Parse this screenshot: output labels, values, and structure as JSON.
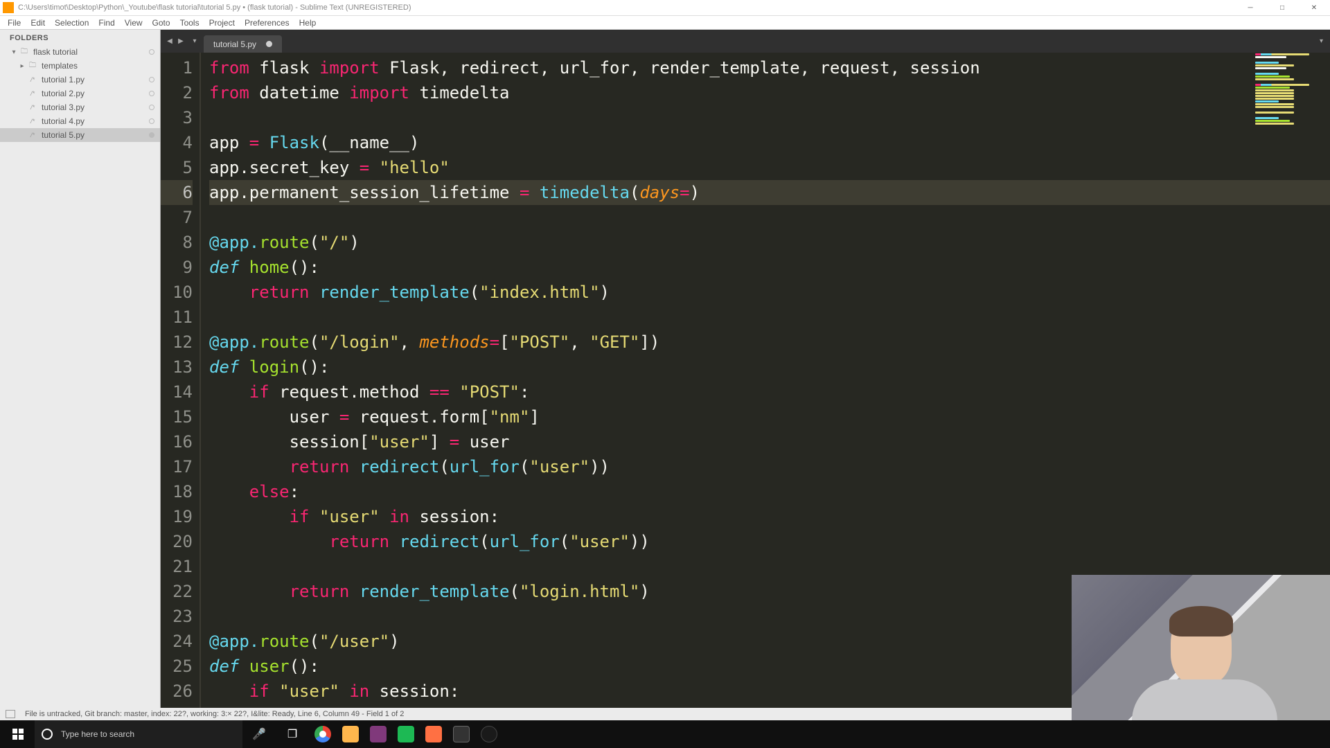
{
  "window": {
    "title": "C:\\Users\\timot\\Desktop\\Python\\_Youtube\\flask tutorial\\tutorial 5.py • (flask tutorial) - Sublime Text (UNREGISTERED)"
  },
  "menu": [
    "File",
    "Edit",
    "Selection",
    "Find",
    "View",
    "Goto",
    "Tools",
    "Project",
    "Preferences",
    "Help"
  ],
  "sidebar": {
    "title": "FOLDERS",
    "root": "flask tutorial",
    "template_folder": "templates",
    "files": [
      "tutorial 1.py",
      "tutorial 2.py",
      "tutorial 3.py",
      "tutorial 4.py",
      "tutorial 5.py"
    ],
    "active_index": 4
  },
  "tab": {
    "name": "tutorial 5.py",
    "dirty": true
  },
  "code": {
    "lines": [
      [
        [
          "kw",
          "from"
        ],
        [
          "pun",
          " flask "
        ],
        [
          "kw",
          "import"
        ],
        [
          "pun",
          " Flask"
        ],
        [
          "pun",
          ", "
        ],
        [
          "pun",
          "redirect"
        ],
        [
          "pun",
          ", "
        ],
        [
          "pun",
          "url_for"
        ],
        [
          "pun",
          ", "
        ],
        [
          "pun",
          "render_template"
        ],
        [
          "pun",
          ", "
        ],
        [
          "pun",
          "request"
        ],
        [
          "pun",
          ", "
        ],
        [
          "pun",
          "session"
        ]
      ],
      [
        [
          "kw",
          "from"
        ],
        [
          "pun",
          " datetime "
        ],
        [
          "kw",
          "import"
        ],
        [
          "pun",
          " timedelta"
        ]
      ],
      [
        [
          "pun",
          ""
        ]
      ],
      [
        [
          "pun",
          "app "
        ],
        [
          "op",
          "="
        ],
        [
          "pun",
          " "
        ],
        [
          "call",
          "Flask"
        ],
        [
          "pun",
          "(__name__)"
        ]
      ],
      [
        [
          "pun",
          "app.secret_key "
        ],
        [
          "op",
          "="
        ],
        [
          "pun",
          " "
        ],
        [
          "str",
          "\"hello\""
        ]
      ],
      [
        [
          "pun",
          "app.permanent_session_lifetime "
        ],
        [
          "op",
          "="
        ],
        [
          "pun",
          " "
        ],
        [
          "call",
          "timedelta"
        ],
        [
          "pun",
          "("
        ],
        [
          "param",
          "days"
        ],
        [
          "op",
          "="
        ],
        [
          "pun",
          ")"
        ]
      ],
      [
        [
          "pun",
          ""
        ]
      ],
      [
        [
          "dec",
          "@app."
        ],
        [
          "name",
          "route"
        ],
        [
          "pun",
          "("
        ],
        [
          "str",
          "\"/\""
        ],
        [
          "pun",
          ")"
        ]
      ],
      [
        [
          "deftxt",
          "def "
        ],
        [
          "fn",
          "home"
        ],
        [
          "pun",
          "():"
        ]
      ],
      [
        [
          "pun",
          "    "
        ],
        [
          "kw",
          "return"
        ],
        [
          "pun",
          " "
        ],
        [
          "call",
          "render_template"
        ],
        [
          "pun",
          "("
        ],
        [
          "str",
          "\"index.html\""
        ],
        [
          "pun",
          ")"
        ]
      ],
      [
        [
          "pun",
          ""
        ]
      ],
      [
        [
          "dec",
          "@app."
        ],
        [
          "name",
          "route"
        ],
        [
          "pun",
          "("
        ],
        [
          "str",
          "\"/login\""
        ],
        [
          "pun",
          ", "
        ],
        [
          "param",
          "methods"
        ],
        [
          "op",
          "="
        ],
        [
          "pun",
          "["
        ],
        [
          "str",
          "\"POST\""
        ],
        [
          "pun",
          ", "
        ],
        [
          "str",
          "\"GET\""
        ],
        [
          "pun",
          "])"
        ]
      ],
      [
        [
          "deftxt",
          "def "
        ],
        [
          "fn",
          "login"
        ],
        [
          "pun",
          "():"
        ]
      ],
      [
        [
          "pun",
          "    "
        ],
        [
          "kw",
          "if"
        ],
        [
          "pun",
          " request.method "
        ],
        [
          "op",
          "=="
        ],
        [
          "pun",
          " "
        ],
        [
          "str",
          "\"POST\""
        ],
        [
          "pun",
          ":"
        ]
      ],
      [
        [
          "pun",
          "        user "
        ],
        [
          "op",
          "="
        ],
        [
          "pun",
          " request.form["
        ],
        [
          "str",
          "\"nm\""
        ],
        [
          "pun",
          "]"
        ]
      ],
      [
        [
          "pun",
          "        session["
        ],
        [
          "str",
          "\"user\""
        ],
        [
          "pun",
          "] "
        ],
        [
          "op",
          "="
        ],
        [
          "pun",
          " user"
        ]
      ],
      [
        [
          "pun",
          "        "
        ],
        [
          "kw",
          "return"
        ],
        [
          "pun",
          " "
        ],
        [
          "call",
          "redirect"
        ],
        [
          "pun",
          "("
        ],
        [
          "call",
          "url_for"
        ],
        [
          "pun",
          "("
        ],
        [
          "str",
          "\"user\""
        ],
        [
          "pun",
          "))"
        ]
      ],
      [
        [
          "pun",
          "    "
        ],
        [
          "kw",
          "else"
        ],
        [
          "pun",
          ":"
        ]
      ],
      [
        [
          "pun",
          "        "
        ],
        [
          "kw",
          "if"
        ],
        [
          "pun",
          " "
        ],
        [
          "str",
          "\"user\""
        ],
        [
          "pun",
          " "
        ],
        [
          "kw",
          "in"
        ],
        [
          "pun",
          " session:"
        ]
      ],
      [
        [
          "pun",
          "            "
        ],
        [
          "kw",
          "return"
        ],
        [
          "pun",
          " "
        ],
        [
          "call",
          "redirect"
        ],
        [
          "pun",
          "("
        ],
        [
          "call",
          "url_for"
        ],
        [
          "pun",
          "("
        ],
        [
          "str",
          "\"user\""
        ],
        [
          "pun",
          "))"
        ]
      ],
      [
        [
          "pun",
          ""
        ]
      ],
      [
        [
          "pun",
          "        "
        ],
        [
          "kw",
          "return"
        ],
        [
          "pun",
          " "
        ],
        [
          "call",
          "render_template"
        ],
        [
          "pun",
          "("
        ],
        [
          "str",
          "\"login.html\""
        ],
        [
          "pun",
          ")"
        ]
      ],
      [
        [
          "pun",
          ""
        ]
      ],
      [
        [
          "dec",
          "@app."
        ],
        [
          "name",
          "route"
        ],
        [
          "pun",
          "("
        ],
        [
          "str",
          "\"/user\""
        ],
        [
          "pun",
          ")"
        ]
      ],
      [
        [
          "deftxt",
          "def "
        ],
        [
          "fn",
          "user"
        ],
        [
          "pun",
          "():"
        ]
      ],
      [
        [
          "pun",
          "    "
        ],
        [
          "kw",
          "if"
        ],
        [
          "pun",
          " "
        ],
        [
          "str",
          "\"user\""
        ],
        [
          "pun",
          " "
        ],
        [
          "kw",
          "in"
        ],
        [
          "pun",
          " session:"
        ]
      ]
    ],
    "active_line": 6
  },
  "status": {
    "text": "File is untracked, Git branch: master, index: 22?, working: 3:× 22?, I&lite: Ready, Line 6, Column 49 - Field 1 of 2"
  },
  "taskbar": {
    "search_placeholder": "Type here to search"
  }
}
